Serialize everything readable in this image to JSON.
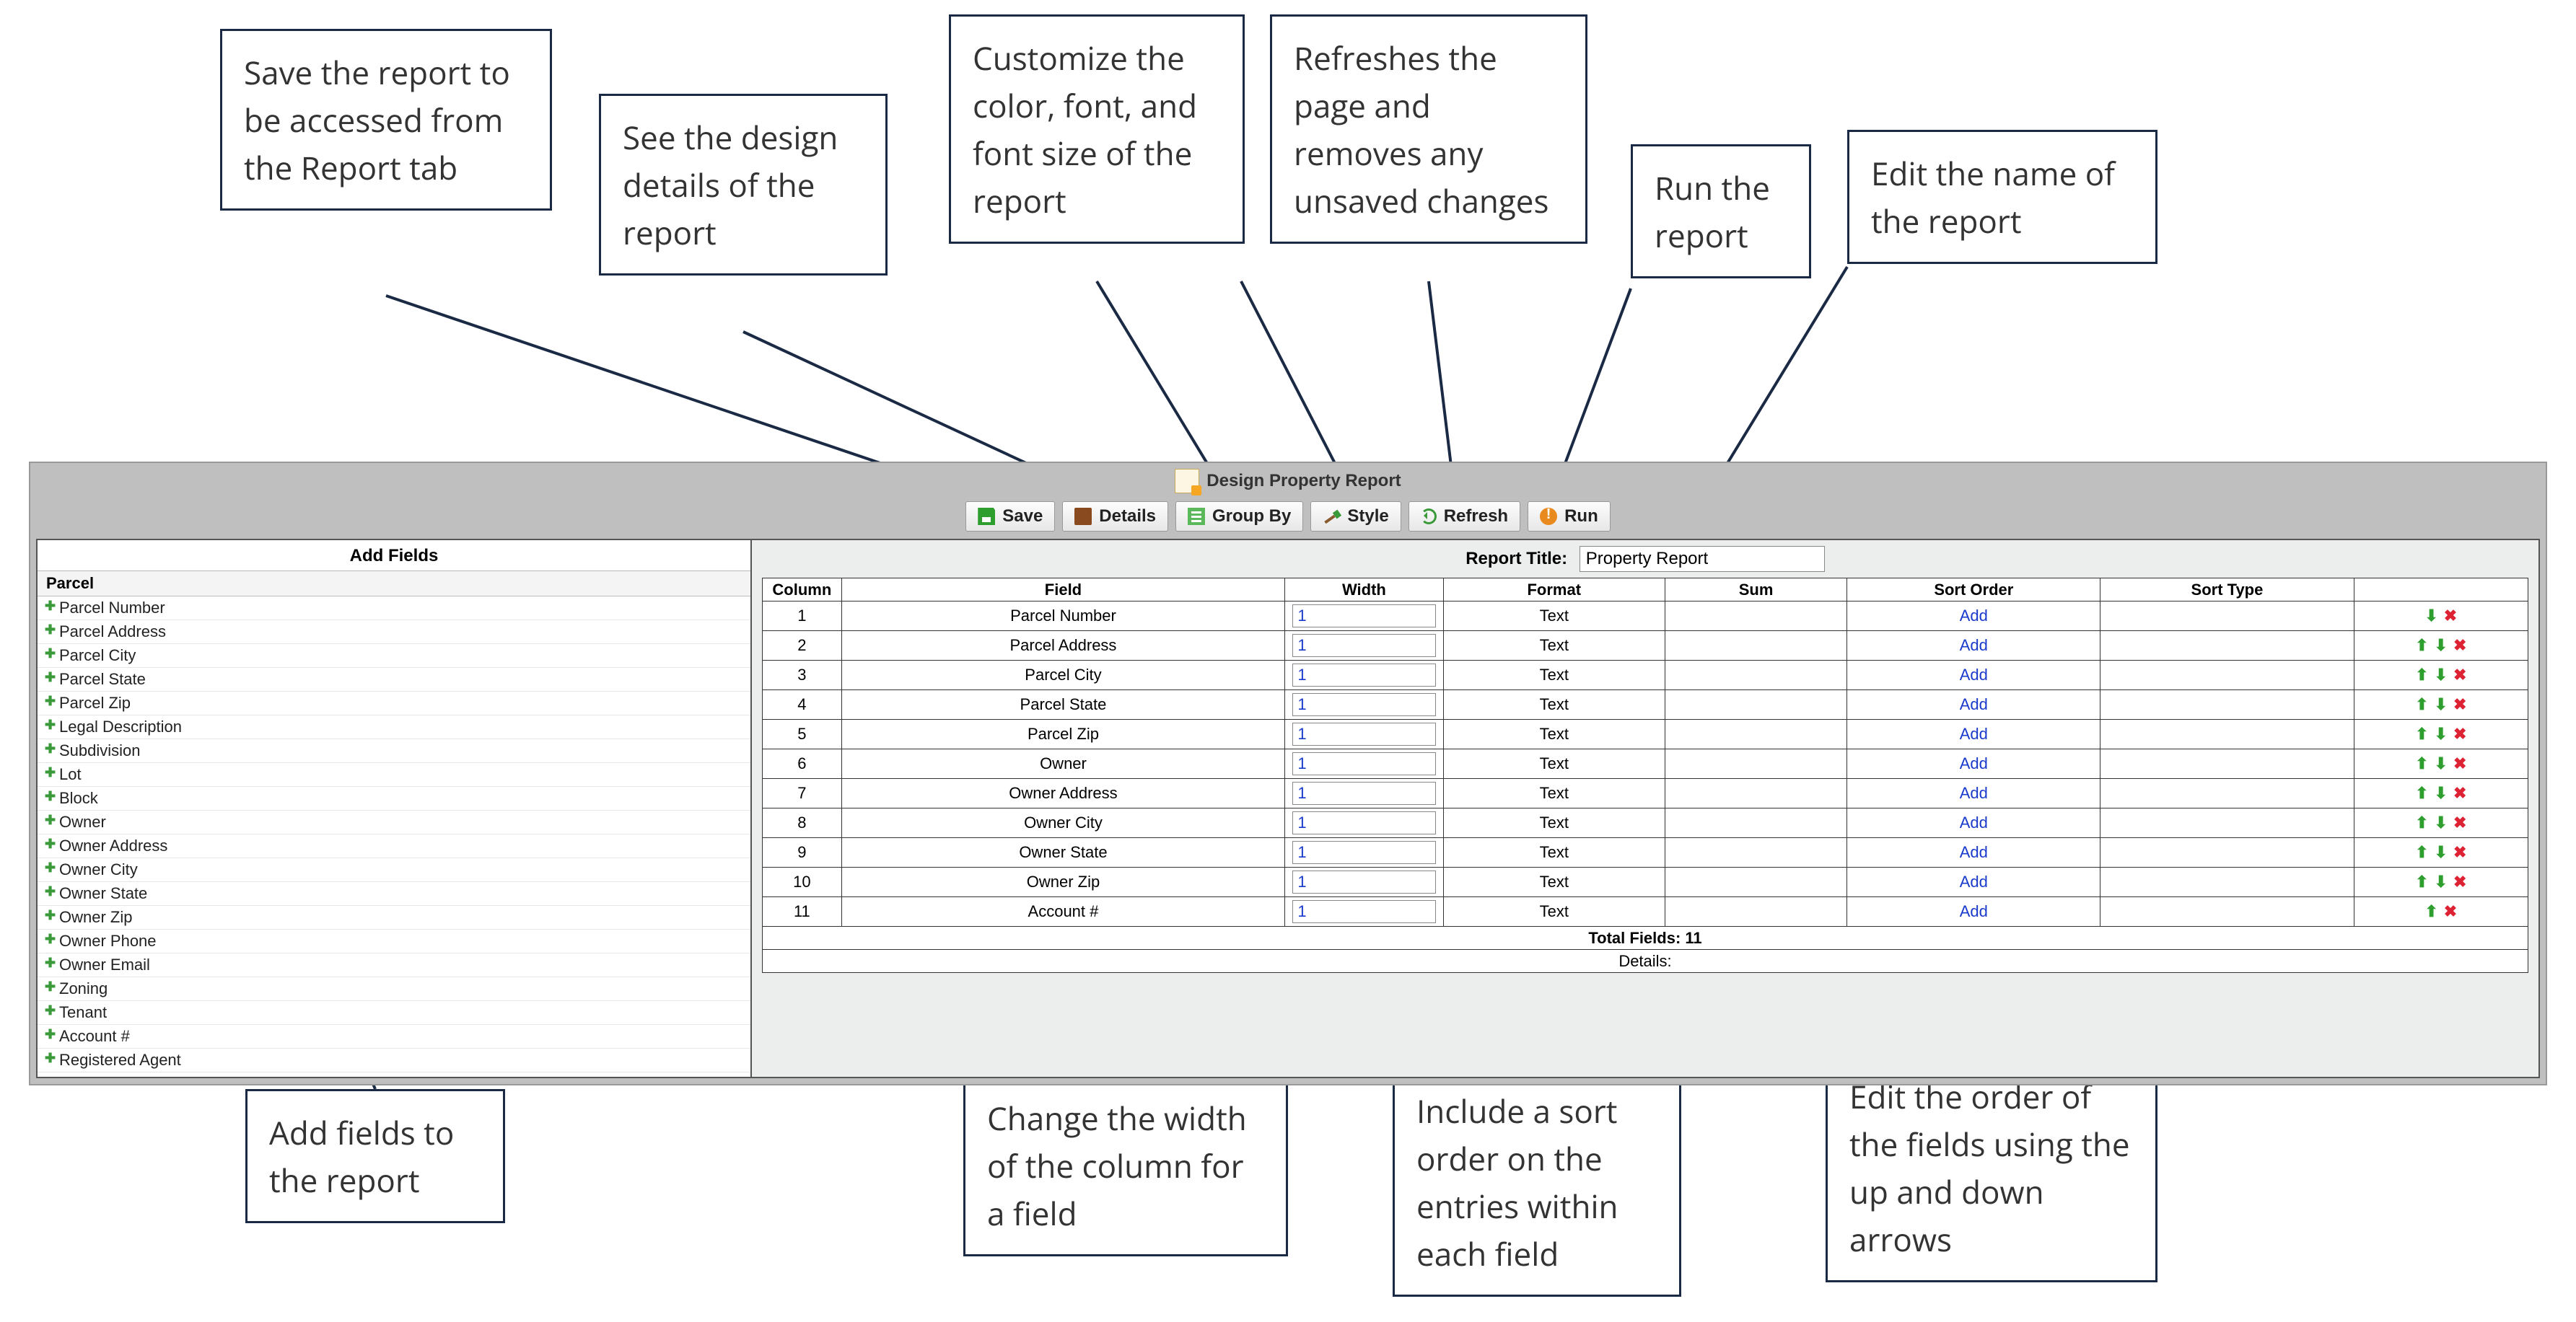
{
  "header": {
    "title": "Design Property Report"
  },
  "toolbar": {
    "save": "Save",
    "details": "Details",
    "groupby": "Group By",
    "style": "Style",
    "refresh": "Refresh",
    "run": "Run"
  },
  "left_panel": {
    "title": "Add Fields",
    "group": "Parcel",
    "fields": [
      "Parcel Number",
      "Parcel Address",
      "Parcel City",
      "Parcel State",
      "Parcel Zip",
      "Legal Description",
      "Subdivision",
      "Lot",
      "Block",
      "Owner",
      "Owner Address",
      "Owner City",
      "Owner State",
      "Owner Zip",
      "Owner Phone",
      "Owner Email",
      "Zoning",
      "Tenant",
      "Account #",
      "Registered Agent"
    ]
  },
  "report_title": {
    "label": "Report Title:",
    "value": "Property Report"
  },
  "grid": {
    "headers": {
      "column": "Column",
      "field": "Field",
      "width": "Width",
      "format": "Format",
      "sum": "Sum",
      "sortorder": "Sort Order",
      "sorttype": "Sort Type",
      "actions": ""
    },
    "rows": [
      {
        "col": "1",
        "field": "Parcel Number",
        "width": "1",
        "format": "Text",
        "sortorder": "Add",
        "up": false,
        "down": true
      },
      {
        "col": "2",
        "field": "Parcel Address",
        "width": "1",
        "format": "Text",
        "sortorder": "Add",
        "up": true,
        "down": true
      },
      {
        "col": "3",
        "field": "Parcel City",
        "width": "1",
        "format": "Text",
        "sortorder": "Add",
        "up": true,
        "down": true
      },
      {
        "col": "4",
        "field": "Parcel State",
        "width": "1",
        "format": "Text",
        "sortorder": "Add",
        "up": true,
        "down": true
      },
      {
        "col": "5",
        "field": "Parcel Zip",
        "width": "1",
        "format": "Text",
        "sortorder": "Add",
        "up": true,
        "down": true
      },
      {
        "col": "6",
        "field": "Owner",
        "width": "1",
        "format": "Text",
        "sortorder": "Add",
        "up": true,
        "down": true
      },
      {
        "col": "7",
        "field": "Owner Address",
        "width": "1",
        "format": "Text",
        "sortorder": "Add",
        "up": true,
        "down": true
      },
      {
        "col": "8",
        "field": "Owner City",
        "width": "1",
        "format": "Text",
        "sortorder": "Add",
        "up": true,
        "down": true
      },
      {
        "col": "9",
        "field": "Owner State",
        "width": "1",
        "format": "Text",
        "sortorder": "Add",
        "up": true,
        "down": true
      },
      {
        "col": "10",
        "field": "Owner Zip",
        "width": "1",
        "format": "Text",
        "sortorder": "Add",
        "up": true,
        "down": true
      },
      {
        "col": "11",
        "field": "Account #",
        "width": "1",
        "format": "Text",
        "sortorder": "Add",
        "up": true,
        "down": false
      }
    ],
    "total_label": "Total Fields: 11",
    "details_label": "Details:"
  },
  "callouts": {
    "save": "Save the report to be accessed from the Report tab",
    "details": "See the design details of the report",
    "style": "Customize the color, font, and font size of the report",
    "refresh": "Refreshes the page and removes any unsaved changes",
    "run": "Run the report",
    "title": "Edit the name of the report",
    "addfields": "Add fields to the report",
    "width": "Change the width of the column for a field",
    "sortorder": "Include a sort order on the entries within each field",
    "reorder": "Edit the order of the fields using the up and down arrows"
  }
}
